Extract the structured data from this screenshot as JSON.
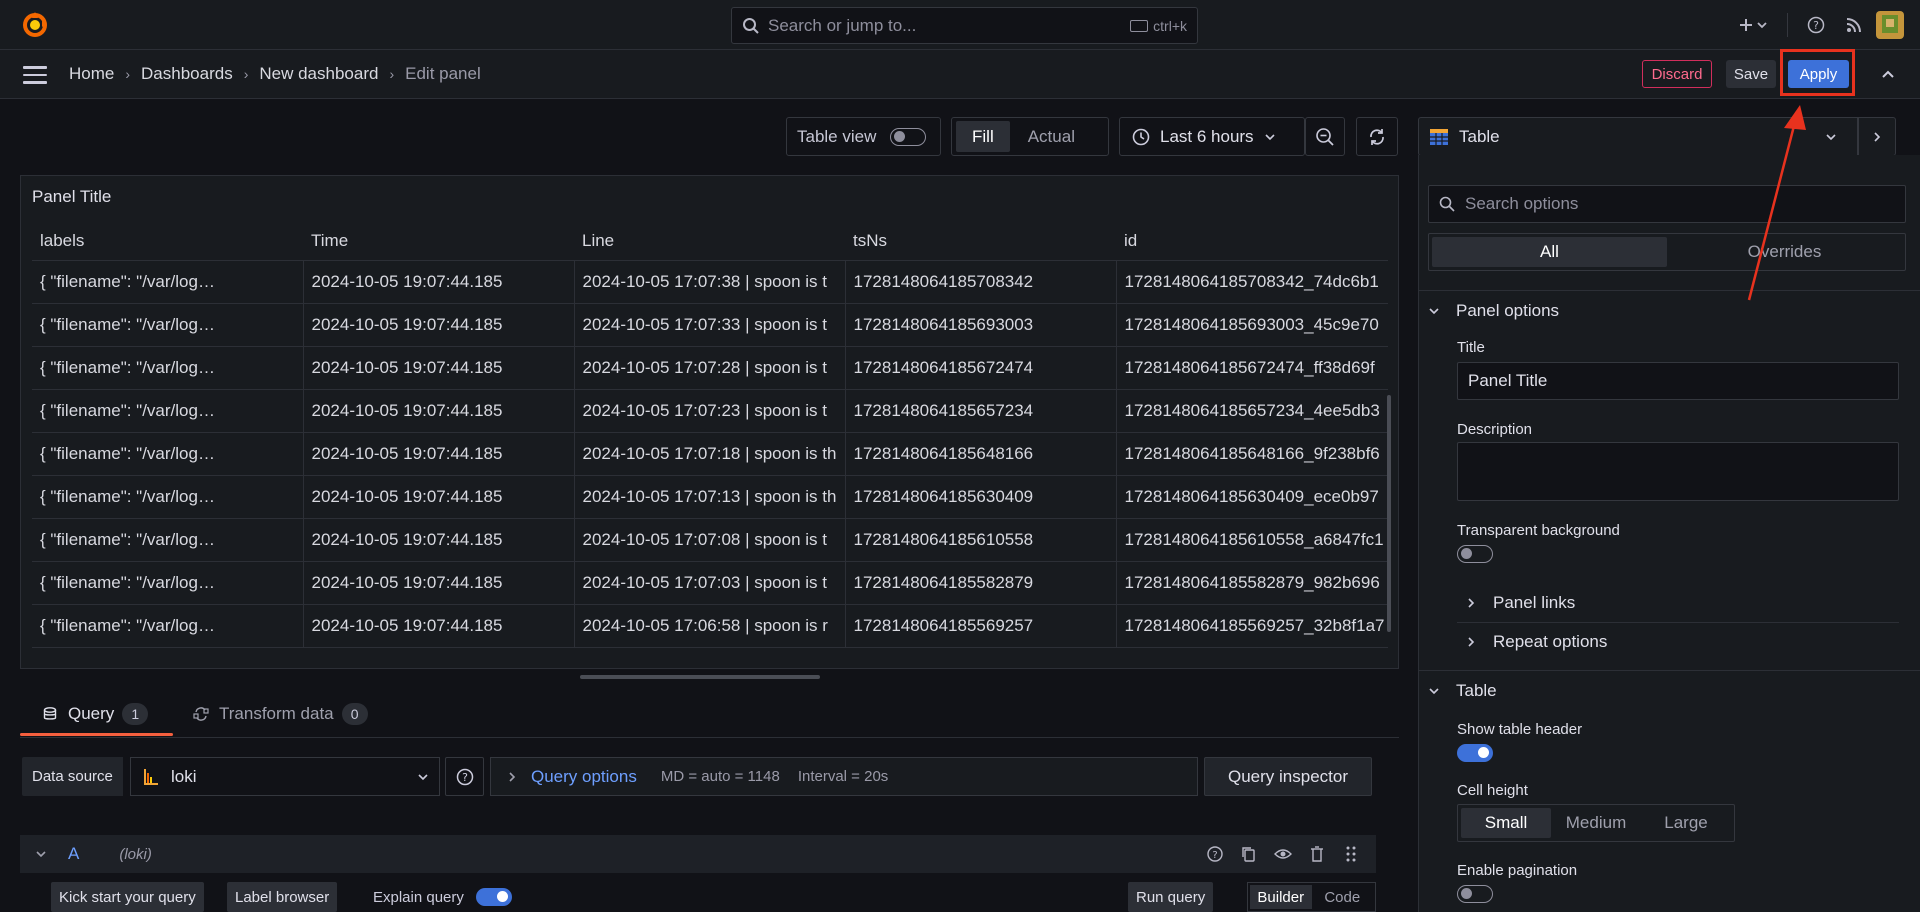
{
  "topbar": {
    "search_placeholder": "Search or jump to...",
    "search_shortcut": "ctrl+k"
  },
  "breadcrumb": {
    "items": [
      "Home",
      "Dashboards",
      "New dashboard",
      "Edit panel"
    ]
  },
  "actions": {
    "discard": "Discard",
    "save": "Save",
    "apply": "Apply"
  },
  "toolbar": {
    "table_view": "Table view",
    "fill": "Fill",
    "actual": "Actual",
    "time_range": "Last 6 hours"
  },
  "panel": {
    "title": "Panel Title",
    "columns": [
      "labels",
      "Time",
      "Line",
      "tsNs",
      "id"
    ],
    "rows": [
      [
        "{ \"filename\": \"/var/log…",
        "2024-10-05 19:07:44.185",
        "2024-10-05 17:07:38 | spoon is t",
        "1728148064185708342",
        "1728148064185708342_74dc6b1"
      ],
      [
        "{ \"filename\": \"/var/log…",
        "2024-10-05 19:07:44.185",
        "2024-10-05 17:07:33 | spoon is t",
        "1728148064185693003",
        "1728148064185693003_45c9e70"
      ],
      [
        "{ \"filename\": \"/var/log…",
        "2024-10-05 19:07:44.185",
        "2024-10-05 17:07:28 | spoon is t",
        "1728148064185672474",
        "1728148064185672474_ff38d69f"
      ],
      [
        "{ \"filename\": \"/var/log…",
        "2024-10-05 19:07:44.185",
        "2024-10-05 17:07:23 | spoon is t",
        "1728148064185657234",
        "1728148064185657234_4ee5db3"
      ],
      [
        "{ \"filename\": \"/var/log…",
        "2024-10-05 19:07:44.185",
        "2024-10-05 17:07:18 | spoon is th",
        "1728148064185648166",
        "1728148064185648166_9f238bf6"
      ],
      [
        "{ \"filename\": \"/var/log…",
        "2024-10-05 19:07:44.185",
        "2024-10-05 17:07:13 | spoon is th",
        "1728148064185630409",
        "1728148064185630409_ece0b97"
      ],
      [
        "{ \"filename\": \"/var/log…",
        "2024-10-05 19:07:44.185",
        "2024-10-05 17:07:08 | spoon is t",
        "1728148064185610558",
        "1728148064185610558_a6847fc1"
      ],
      [
        "{ \"filename\": \"/var/log…",
        "2024-10-05 19:07:44.185",
        "2024-10-05 17:07:03 | spoon is t",
        "1728148064185582879",
        "1728148064185582879_982b696"
      ],
      [
        "{ \"filename\": \"/var/log…",
        "2024-10-05 19:07:44.185",
        "2024-10-05 17:06:58 | spoon is r",
        "1728148064185569257",
        "1728148064185569257_32b8f1a7"
      ]
    ]
  },
  "query_tabs": {
    "query": "Query",
    "query_count": "1",
    "transform": "Transform data",
    "transform_count": "0"
  },
  "query": {
    "data_source_label": "Data source",
    "data_source": "loki",
    "options_label": "Query options",
    "md": "MD = auto = 1148",
    "interval": "Interval = 20s",
    "inspector": "Query inspector",
    "ref_id": "A",
    "ds_hint": "(loki)",
    "kick_start": "Kick start your query",
    "label_browser": "Label browser",
    "explain": "Explain query",
    "run": "Run query",
    "builder": "Builder",
    "code": "Code"
  },
  "options": {
    "viz": "Table",
    "search_placeholder": "Search options",
    "tab_all": "All",
    "tab_overrides": "Overrides",
    "panel_options": "Panel options",
    "title_label": "Title",
    "title_value": "Panel Title",
    "description_label": "Description",
    "transparent_label": "Transparent background",
    "panel_links": "Panel links",
    "repeat_options": "Repeat options",
    "table_section": "Table",
    "show_header": "Show table header",
    "cell_height": "Cell height",
    "cell_small": "Small",
    "cell_medium": "Medium",
    "cell_large": "Large",
    "pagination": "Enable pagination"
  },
  "colors": {
    "accent": "#3d71d9",
    "highlight": "#e8321e",
    "tab_underline": "#f55f3e"
  }
}
